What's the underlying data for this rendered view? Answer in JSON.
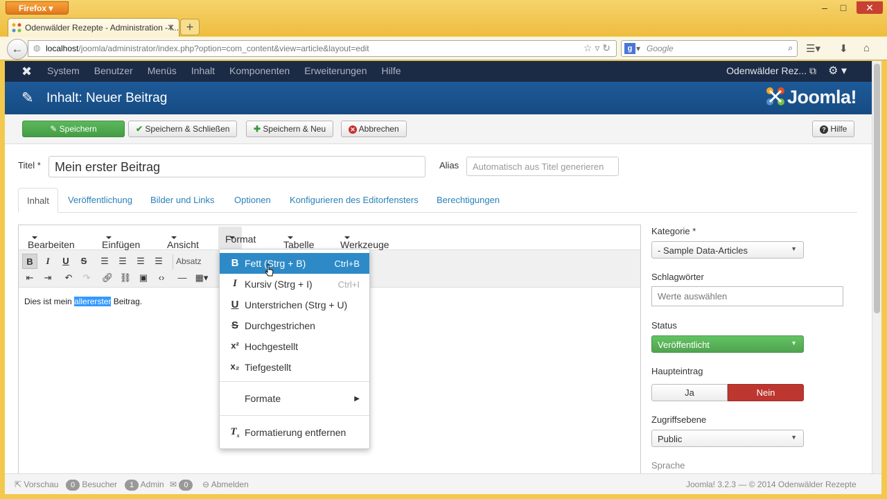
{
  "browser": {
    "app_button": "Firefox",
    "tab_title": "Odenwälder Rezepte - Administration - l...",
    "url_host": "localhost",
    "url_path": "/joomla/administrator/index.php?option=com_content&view=article&layout=edit",
    "search_placeholder": "Google"
  },
  "topnav": {
    "items": [
      "System",
      "Benutzer",
      "Menüs",
      "Inhalt",
      "Komponenten",
      "Erweiterungen",
      "Hilfe"
    ],
    "site": "Odenwälder Rez..."
  },
  "header": {
    "title": "Inhalt: Neuer Beitrag",
    "brand": "Joomla!"
  },
  "toolbar": {
    "save": "Speichern",
    "save_close": "Speichern & Schließen",
    "save_new": "Speichern & Neu",
    "cancel": "Abbrechen",
    "help": "Hilfe"
  },
  "form": {
    "title_label": "Titel *",
    "title_value": "Mein erster Beitrag",
    "alias_label": "Alias",
    "alias_placeholder": "Automatisch aus Titel generieren"
  },
  "tabs": [
    "Inhalt",
    "Veröffentlichung",
    "Bilder und Links",
    "Optionen",
    "Konfigurieren des Editorfensters",
    "Berechtigungen"
  ],
  "editor": {
    "menu": [
      "Bearbeiten",
      "Einfügen",
      "Ansicht",
      "Format",
      "Tabelle",
      "Werkzeuge"
    ],
    "block_format": "Absatz",
    "content_before": "Dies ist mein ",
    "content_selected": "allererster",
    "content_after": " Beitrag."
  },
  "format_menu": {
    "items": [
      {
        "label": "Fett (Strg + B)",
        "shortcut": "Ctrl+B",
        "icon": "B"
      },
      {
        "label": "Kursiv (Strg + I)",
        "shortcut": "Ctrl+I",
        "icon": "I"
      },
      {
        "label": "Unterstrichen (Strg + U)",
        "shortcut": "",
        "icon": "U"
      },
      {
        "label": "Durchgestrichen",
        "shortcut": "",
        "icon": "S"
      },
      {
        "label": "Hochgestellt",
        "shortcut": "",
        "icon": "x²"
      },
      {
        "label": "Tiefgestellt",
        "shortcut": "",
        "icon": "x₂"
      }
    ],
    "formats": "Formate",
    "clear": "Formatierung entfernen"
  },
  "sidebar": {
    "category_label": "Kategorie *",
    "category_value": "- Sample Data-Articles",
    "tags_label": "Schlagwörter",
    "tags_placeholder": "Werte auswählen",
    "status_label": "Status",
    "status_value": "Veröffentlicht",
    "featured_label": "Haupteintrag",
    "featured_yes": "Ja",
    "featured_no": "Nein",
    "access_label": "Zugriffsebene",
    "access_value": "Public",
    "language_label": "Sprache"
  },
  "footer": {
    "preview": "Vorschau",
    "visitors_count": "0",
    "visitors": "Besucher",
    "admin_count": "1",
    "admin": "Admin",
    "messages_count": "0",
    "logout": "Abmelden",
    "version": "Joomla! 3.2.3  —  © 2014 Odenwälder Rezepte"
  },
  "colors": {
    "topnav": "#1b2a45",
    "header": "#1d5a99",
    "save_green": "#5cb85c",
    "menu_highlight": "#2d8ac7",
    "no_red": "#bd362f"
  }
}
